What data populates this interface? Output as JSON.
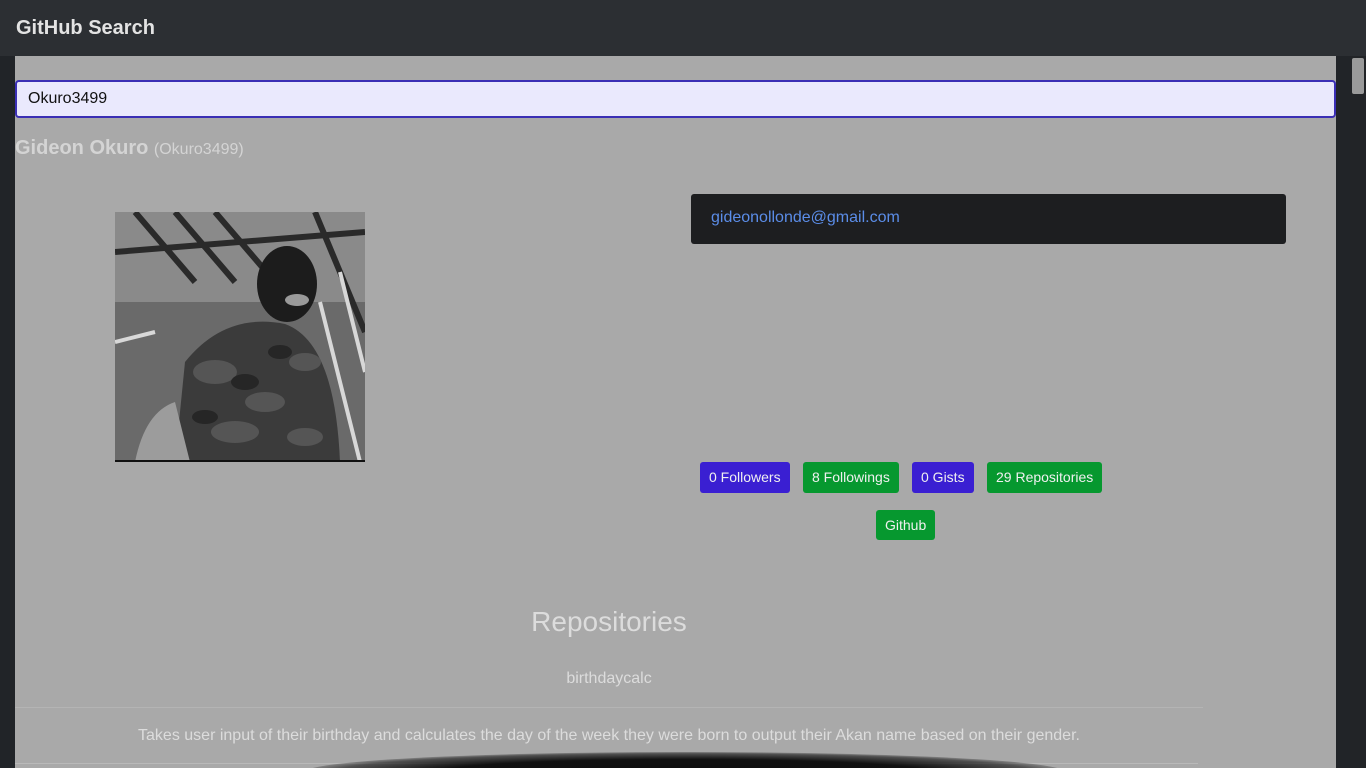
{
  "navbar": {
    "brand": "GitHub Search"
  },
  "search": {
    "value": "Okuro3499"
  },
  "profile": {
    "name": "Gideon Okuro",
    "login": "(Okuro3499)",
    "email": "gideonollonde@gmail.com"
  },
  "stats": {
    "followers": "0 Followers",
    "followings": "8 Followings",
    "gists": "0 Gists",
    "repositories": "29 Repositories"
  },
  "github_button": "Github",
  "repos": {
    "heading": "Repositories",
    "items": [
      {
        "name": "birthdaycalc",
        "description": "Takes user input of their birthday and calculates the day of the week they were born to output their Akan name based on their gender."
      }
    ]
  },
  "colors": {
    "navbar": "#2c2f33",
    "panel": "#a9a9a9",
    "badge_blue": "#3a1fd2",
    "badge_green": "#06982f",
    "email_link": "#5b8de8"
  }
}
